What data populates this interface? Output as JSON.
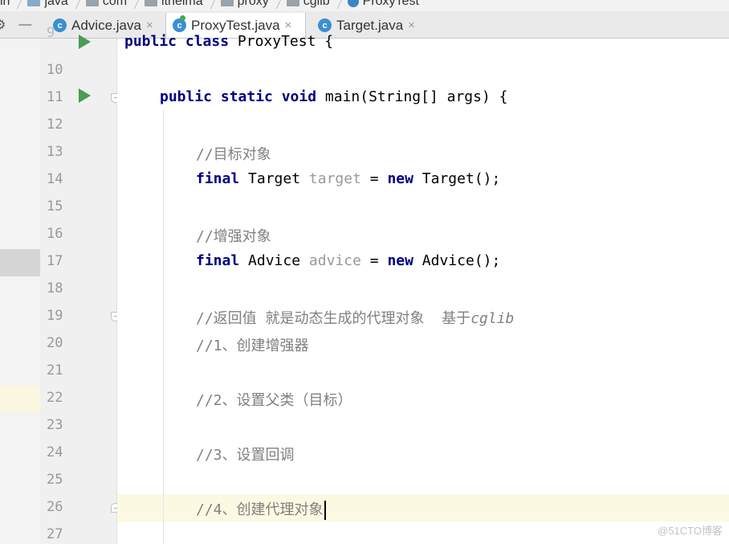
{
  "breadcrumb": [
    {
      "label": "in",
      "icon": "none"
    },
    {
      "label": "java",
      "icon": "folder-icon"
    },
    {
      "label": "com",
      "icon": "package-icon"
    },
    {
      "label": "itheima",
      "icon": "package-icon"
    },
    {
      "label": "proxy",
      "icon": "package-icon"
    },
    {
      "label": "cglib",
      "icon": "package-icon"
    },
    {
      "label": "ProxyTest",
      "icon": "class-icon"
    }
  ],
  "toolbar": {
    "settings_glyph": "⚙",
    "hide_glyph": "—"
  },
  "tabs": [
    {
      "label": "Advice.java",
      "close": "×",
      "active": false
    },
    {
      "label": "ProxyTest.java",
      "close": "×",
      "active": true
    },
    {
      "label": "Target.java",
      "close": "×",
      "active": false
    }
  ],
  "code_lines": [
    {
      "n": "10"
    },
    {
      "n": "11"
    },
    {
      "n": "12"
    },
    {
      "n": "13"
    },
    {
      "n": "14"
    },
    {
      "n": "15"
    },
    {
      "n": "16"
    },
    {
      "n": "17"
    },
    {
      "n": "18"
    },
    {
      "n": "19"
    },
    {
      "n": "20"
    },
    {
      "n": "21"
    },
    {
      "n": "22"
    },
    {
      "n": "23"
    },
    {
      "n": "24"
    },
    {
      "n": "25"
    },
    {
      "n": "26"
    },
    {
      "n": "27"
    }
  ],
  "code": {
    "l9": {
      "kw1": "public class ",
      "rest": "ProxyTest {"
    },
    "l11": {
      "kw": "public static void ",
      "rest": "main(String[] args) {"
    },
    "l13": {
      "comment": "//目标对象"
    },
    "l14": {
      "kw": "final ",
      "type": "Target ",
      "var": "target",
      "op": " = ",
      "kw2": "new ",
      "rest": "Target();"
    },
    "l16": {
      "comment": "//增强对象"
    },
    "l17": {
      "kw": "final ",
      "type": "Advice ",
      "var": "advice",
      "op": " = ",
      "kw2": "new ",
      "rest": "Advice();"
    },
    "l19": {
      "comment": "//返回值 就是动态生成的代理对象  基于",
      "comment_i": "cglib"
    },
    "l20": {
      "comment": "//1、创建增强器"
    },
    "l22": {
      "comment": "//2、设置父类（目标）"
    },
    "l24": {
      "comment": "//3、设置回调"
    },
    "l26": {
      "comment": "//4、创建代理对象"
    }
  },
  "watermark": "@51CTO博客",
  "colors": {
    "keyword": "#000080",
    "comment": "#808080",
    "unused_var": "#999999",
    "caret_line": "#fcf9e3",
    "run_icon": "#499c54"
  }
}
